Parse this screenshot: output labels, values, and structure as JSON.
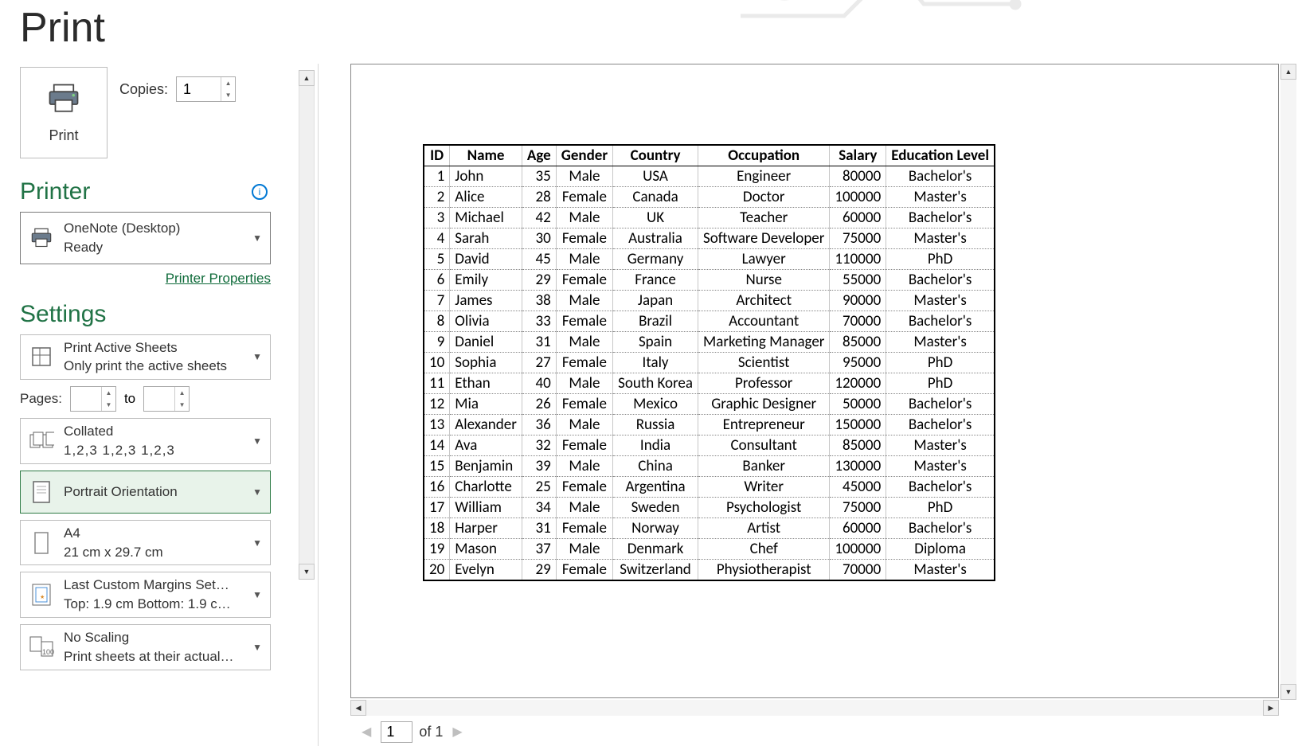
{
  "page_title": "Print",
  "copies": {
    "label": "Copies:",
    "value": "1"
  },
  "print_button_label": "Print",
  "printer_section": "Printer",
  "printer_selected": {
    "name": "OneNote (Desktop)",
    "status": "Ready"
  },
  "printer_properties_link": "Printer Properties",
  "settings_section": "Settings",
  "settings": {
    "print_what": {
      "main": "Print Active Sheets",
      "sub": "Only print the active sheets"
    },
    "pages_label": "Pages:",
    "pages_from": "",
    "pages_to_label": "to",
    "pages_to": "",
    "collate": {
      "main": "Collated",
      "sub": "1,2,3    1,2,3    1,2,3"
    },
    "orientation": {
      "main": "Portrait Orientation"
    },
    "paper": {
      "main": "A4",
      "sub": "21 cm x 29.7 cm"
    },
    "margins": {
      "main": "Last Custom Margins Set…",
      "sub": "Top: 1.9 cm Bottom: 1.9 c…"
    },
    "scaling": {
      "main": "No Scaling",
      "sub": "Print sheets at their actual…"
    }
  },
  "nav": {
    "current": "1",
    "total": "of 1"
  },
  "table": {
    "headers": [
      "ID",
      "Name",
      "Age",
      "Gender",
      "Country",
      "Occupation",
      "Salary",
      "Education Level"
    ],
    "rows": [
      [
        "1",
        "John",
        "35",
        "Male",
        "USA",
        "Engineer",
        "80000",
        "Bachelor's"
      ],
      [
        "2",
        "Alice",
        "28",
        "Female",
        "Canada",
        "Doctor",
        "100000",
        "Master's"
      ],
      [
        "3",
        "Michael",
        "42",
        "Male",
        "UK",
        "Teacher",
        "60000",
        "Bachelor's"
      ],
      [
        "4",
        "Sarah",
        "30",
        "Female",
        "Australia",
        "Software Developer",
        "75000",
        "Master's"
      ],
      [
        "5",
        "David",
        "45",
        "Male",
        "Germany",
        "Lawyer",
        "110000",
        "PhD"
      ],
      [
        "6",
        "Emily",
        "29",
        "Female",
        "France",
        "Nurse",
        "55000",
        "Bachelor's"
      ],
      [
        "7",
        "James",
        "38",
        "Male",
        "Japan",
        "Architect",
        "90000",
        "Master's"
      ],
      [
        "8",
        "Olivia",
        "33",
        "Female",
        "Brazil",
        "Accountant",
        "70000",
        "Bachelor's"
      ],
      [
        "9",
        "Daniel",
        "31",
        "Male",
        "Spain",
        "Marketing Manager",
        "85000",
        "Master's"
      ],
      [
        "10",
        "Sophia",
        "27",
        "Female",
        "Italy",
        "Scientist",
        "95000",
        "PhD"
      ],
      [
        "11",
        "Ethan",
        "40",
        "Male",
        "South Korea",
        "Professor",
        "120000",
        "PhD"
      ],
      [
        "12",
        "Mia",
        "26",
        "Female",
        "Mexico",
        "Graphic Designer",
        "50000",
        "Bachelor's"
      ],
      [
        "13",
        "Alexander",
        "36",
        "Male",
        "Russia",
        "Entrepreneur",
        "150000",
        "Bachelor's"
      ],
      [
        "14",
        "Ava",
        "32",
        "Female",
        "India",
        "Consultant",
        "85000",
        "Master's"
      ],
      [
        "15",
        "Benjamin",
        "39",
        "Male",
        "China",
        "Banker",
        "130000",
        "Master's"
      ],
      [
        "16",
        "Charlotte",
        "25",
        "Female",
        "Argentina",
        "Writer",
        "45000",
        "Bachelor's"
      ],
      [
        "17",
        "William",
        "34",
        "Male",
        "Sweden",
        "Psychologist",
        "75000",
        "PhD"
      ],
      [
        "18",
        "Harper",
        "31",
        "Female",
        "Norway",
        "Artist",
        "60000",
        "Bachelor's"
      ],
      [
        "19",
        "Mason",
        "37",
        "Male",
        "Denmark",
        "Chef",
        "100000",
        "Diploma"
      ],
      [
        "20",
        "Evelyn",
        "29",
        "Female",
        "Switzerland",
        "Physiotherapist",
        "70000",
        "Master's"
      ]
    ]
  }
}
